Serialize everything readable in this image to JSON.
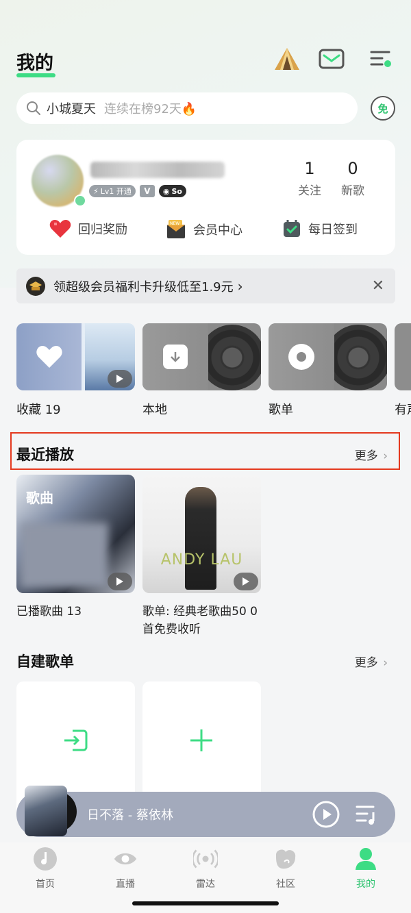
{
  "header": {
    "title": "我的"
  },
  "search": {
    "query": "小城夏天",
    "hint": "连续在榜92天🔥",
    "free_badge": "免"
  },
  "profile": {
    "level_badge": "Lv1 开通",
    "v_badge": "V",
    "so_badge": "So",
    "follow_count": "1",
    "follow_label": "关注",
    "new_songs_count": "0",
    "new_songs_label": "新歌",
    "quick_actions": [
      {
        "label": "回归奖励",
        "icon": "pixel-heart-icon"
      },
      {
        "label": "会员中心",
        "icon": "vip-envelope-icon"
      },
      {
        "label": "每日签到",
        "icon": "calendar-check-icon"
      }
    ]
  },
  "promo": {
    "text": "领超级会员福利卡升级低至1.9元",
    "chevron": "›",
    "close": "✕"
  },
  "library": [
    {
      "label": "收藏 19",
      "icon": "heart-icon"
    },
    {
      "label": "本地",
      "icon": "download-icon"
    },
    {
      "label": "歌单",
      "icon": "disc-icon"
    },
    {
      "label": "有声",
      "icon": "audio-icon"
    }
  ],
  "recent": {
    "title": "最近播放",
    "more": "更多",
    "items": [
      {
        "overlay": "歌曲",
        "label": "已播歌曲 13"
      },
      {
        "overlay": "ANDY LAU",
        "label": "歌单: 经典老歌曲50 0首免费收听"
      }
    ]
  },
  "custom_playlists": {
    "title": "自建歌单",
    "more": "更多"
  },
  "player": {
    "song": "日不落 - 蔡依林"
  },
  "bottom_nav": [
    {
      "label": "首页",
      "icon": "music-note-icon",
      "active": false
    },
    {
      "label": "直播",
      "icon": "eye-icon",
      "active": false
    },
    {
      "label": "雷达",
      "icon": "radar-icon",
      "active": false
    },
    {
      "label": "社区",
      "icon": "community-icon",
      "active": false
    },
    {
      "label": "我的",
      "icon": "profile-icon",
      "active": true
    }
  ],
  "colors": {
    "accent": "#3ddc84",
    "highlight_border": "#e4391e",
    "player_bar": "#a3aabc"
  }
}
